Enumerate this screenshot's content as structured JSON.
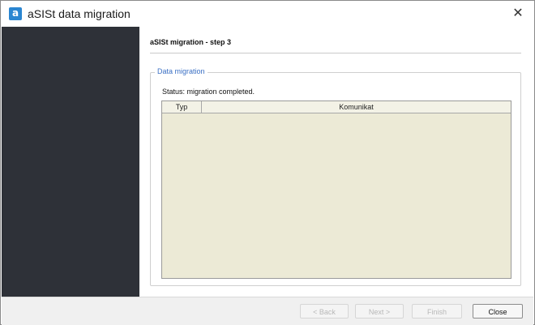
{
  "window": {
    "title": "aSISt data migration",
    "app_icon_glyph": "a",
    "close_glyph": "✕"
  },
  "content": {
    "step_title": "aSISt migration - step 3",
    "group_label": "Data migration",
    "status": "Status: migration completed.",
    "table": {
      "columns": [
        "Typ",
        "Komunikat"
      ],
      "rows": []
    }
  },
  "footer": {
    "back_label": "< Back",
    "next_label": "Next >",
    "finish_label": "Finish",
    "close_label": "Close"
  },
  "colors": {
    "sidebar": "#2e3138",
    "table_background": "#ecead6",
    "group_label": "#3a6fc4",
    "app_icon": "#2b86d1"
  },
  "icons": {
    "app": "app-icon",
    "close": "close-icon"
  }
}
